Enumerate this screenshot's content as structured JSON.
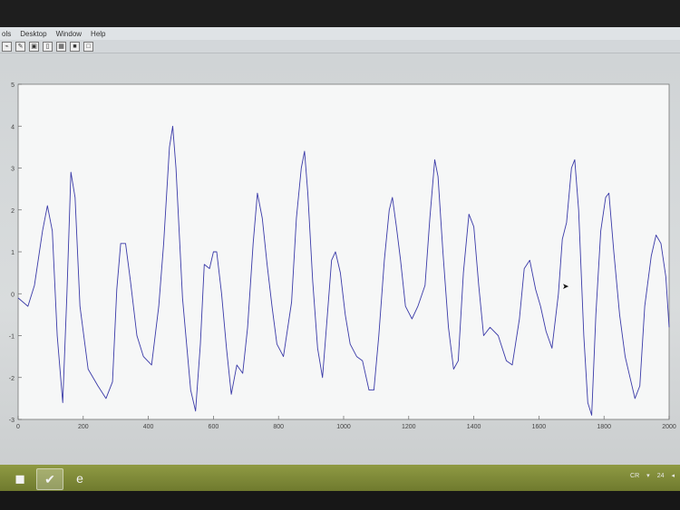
{
  "menu": {
    "items": [
      "ols",
      "Desktop",
      "Window",
      "Help"
    ]
  },
  "toolbar": {
    "buttons": [
      {
        "icon": "arrow-icon",
        "glyph": "⌁"
      },
      {
        "icon": "pen-icon",
        "glyph": "✎"
      },
      {
        "icon": "print-icon",
        "glyph": "▣"
      },
      {
        "icon": "panel-icon",
        "glyph": "▯"
      },
      {
        "icon": "grid-icon",
        "glyph": "▦"
      },
      {
        "icon": "stop-icon",
        "glyph": "■"
      },
      {
        "icon": "window-icon",
        "glyph": "□"
      }
    ]
  },
  "chart_data": {
    "type": "line",
    "xlim": [
      0,
      2000
    ],
    "ylim": [
      -3,
      5
    ],
    "x_ticks": [
      0,
      200,
      400,
      600,
      800,
      1000,
      1200,
      1400,
      1600,
      1800,
      2000
    ],
    "y_ticks": [
      -3,
      -2,
      -1,
      0,
      1,
      2,
      3,
      4,
      5
    ],
    "grid": false,
    "line_color": "#3a3aa8",
    "series": [
      {
        "points": [
          [
            0,
            -0.1
          ],
          [
            30,
            -0.3
          ],
          [
            50,
            0.2
          ],
          [
            75,
            1.5
          ],
          [
            90,
            2.1
          ],
          [
            105,
            1.5
          ],
          [
            120,
            -1.0
          ],
          [
            137,
            -2.6
          ],
          [
            150,
            0.0
          ],
          [
            162,
            2.9
          ],
          [
            175,
            2.3
          ],
          [
            190,
            -0.3
          ],
          [
            215,
            -1.8
          ],
          [
            245,
            -2.2
          ],
          [
            270,
            -2.5
          ],
          [
            290,
            -2.1
          ],
          [
            303,
            0.1
          ],
          [
            315,
            1.2
          ],
          [
            330,
            1.2
          ],
          [
            345,
            0.3
          ],
          [
            365,
            -1.0
          ],
          [
            385,
            -1.5
          ],
          [
            410,
            -1.7
          ],
          [
            432,
            -0.3
          ],
          [
            447,
            1.2
          ],
          [
            465,
            3.5
          ],
          [
            475,
            4.0
          ],
          [
            485,
            3.0
          ],
          [
            505,
            -0.1
          ],
          [
            530,
            -2.3
          ],
          [
            545,
            -2.8
          ],
          [
            560,
            -1.2
          ],
          [
            572,
            0.7
          ],
          [
            588,
            0.6
          ],
          [
            600,
            1.0
          ],
          [
            610,
            1.0
          ],
          [
            625,
            0.0
          ],
          [
            640,
            -1.3
          ],
          [
            655,
            -2.4
          ],
          [
            672,
            -1.7
          ],
          [
            690,
            -1.9
          ],
          [
            705,
            -0.8
          ],
          [
            722,
            1.2
          ],
          [
            735,
            2.4
          ],
          [
            750,
            1.8
          ],
          [
            765,
            0.7
          ],
          [
            780,
            -0.3
          ],
          [
            795,
            -1.2
          ],
          [
            815,
            -1.5
          ],
          [
            840,
            -0.2
          ],
          [
            855,
            1.8
          ],
          [
            870,
            3.0
          ],
          [
            880,
            3.4
          ],
          [
            890,
            2.4
          ],
          [
            905,
            0.3
          ],
          [
            920,
            -1.3
          ],
          [
            935,
            -2.0
          ],
          [
            950,
            -0.5
          ],
          [
            963,
            0.8
          ],
          [
            975,
            1.0
          ],
          [
            990,
            0.5
          ],
          [
            1005,
            -0.5
          ],
          [
            1020,
            -1.2
          ],
          [
            1040,
            -1.5
          ],
          [
            1058,
            -1.6
          ],
          [
            1078,
            -2.3
          ],
          [
            1093,
            -2.3
          ],
          [
            1108,
            -1.0
          ],
          [
            1125,
            0.8
          ],
          [
            1140,
            2.0
          ],
          [
            1150,
            2.3
          ],
          [
            1162,
            1.6
          ],
          [
            1175,
            0.8
          ],
          [
            1190,
            -0.3
          ],
          [
            1210,
            -0.6
          ],
          [
            1228,
            -0.3
          ],
          [
            1250,
            0.2
          ],
          [
            1265,
            1.8
          ],
          [
            1280,
            3.2
          ],
          [
            1290,
            2.8
          ],
          [
            1305,
            1.0
          ],
          [
            1322,
            -0.8
          ],
          [
            1338,
            -1.8
          ],
          [
            1352,
            -1.6
          ],
          [
            1368,
            0.5
          ],
          [
            1385,
            1.9
          ],
          [
            1400,
            1.6
          ],
          [
            1415,
            0.2
          ],
          [
            1430,
            -1.0
          ],
          [
            1450,
            -0.8
          ],
          [
            1475,
            -1.0
          ],
          [
            1500,
            -1.6
          ],
          [
            1518,
            -1.7
          ],
          [
            1540,
            -0.6
          ],
          [
            1555,
            0.6
          ],
          [
            1572,
            0.8
          ],
          [
            1590,
            0.1
          ],
          [
            1605,
            -0.3
          ],
          [
            1622,
            -0.9
          ],
          [
            1640,
            -1.3
          ],
          [
            1660,
            0.0
          ],
          [
            1672,
            1.3
          ],
          [
            1685,
            1.7
          ],
          [
            1700,
            3.0
          ],
          [
            1710,
            3.2
          ],
          [
            1722,
            2.0
          ],
          [
            1738,
            -1.0
          ],
          [
            1750,
            -2.6
          ],
          [
            1762,
            -2.9
          ],
          [
            1775,
            -0.5
          ],
          [
            1790,
            1.5
          ],
          [
            1805,
            2.3
          ],
          [
            1815,
            2.4
          ],
          [
            1830,
            1.0
          ],
          [
            1848,
            -0.5
          ],
          [
            1865,
            -1.5
          ],
          [
            1880,
            -2.0
          ],
          [
            1895,
            -2.5
          ],
          [
            1910,
            -2.2
          ],
          [
            1925,
            -0.3
          ],
          [
            1945,
            0.9
          ],
          [
            1960,
            1.4
          ],
          [
            1975,
            1.2
          ],
          [
            1990,
            0.4
          ],
          [
            2000,
            -0.8
          ]
        ]
      }
    ]
  },
  "taskbar": {
    "buttons": [
      {
        "name": "start-button",
        "glyph": "◼",
        "active": false
      },
      {
        "name": "matlab-taskbar-button",
        "glyph": "✔",
        "active": true
      },
      {
        "name": "ie-taskbar-button",
        "glyph": "e",
        "active": false
      }
    ],
    "tray": {
      "lang": "CR",
      "time": "24"
    }
  }
}
